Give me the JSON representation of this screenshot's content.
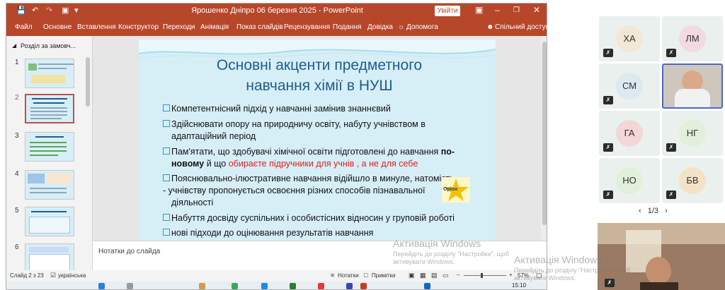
{
  "window": {
    "title": "Ярошенко Дніпро 06 березня  2025  -  PowerPoint",
    "sign_in": "Увійти"
  },
  "ribbon": {
    "tabs": [
      "Файл",
      "Основне",
      "Вставлення",
      "Конструктор",
      "Переходи",
      "Анімація",
      "Показ слайдів",
      "Рецензування",
      "Подання",
      "Довідка"
    ],
    "help": "Допомога",
    "share": "Спільний доступ"
  },
  "sidebar": {
    "section": "Розділ за замовч...",
    "slides": [
      "1",
      "2",
      "3",
      "4",
      "5",
      "6"
    ],
    "selected": "2"
  },
  "slide": {
    "title_line1": "Основні  акценти  предметного",
    "title_line2": "навчання хімії в НУШ",
    "bullets": [
      {
        "text": "Компетентнісний підхід  у навчанні замінив знаннєвий"
      },
      {
        "text": "Здійснювати опору на природничу освіту, набуту учнівством  в",
        "cont": "адаптаційний період"
      },
      {
        "pre": "Пам'ятати, що здобувачі хімічної освіти підготовлені до навчання ",
        "bold1": "по-",
        "bold2": "новому",
        "mid": "  й що ",
        "red": "обираєте підручники для учнів , а не для себе"
      },
      {
        "text": "Пояснювально-ілюстративне навчання відійшло в минуле, натомість",
        "cont": "- учнівству пропонується освоєння різних  способів пізнавальної",
        "cont2": "діяльності"
      },
      {
        "text": "Набуття досвіду суспільних і особистісних відносин у груповій роботі"
      },
      {
        "text": "нові підходи до оцінювання результатів навчання"
      }
    ],
    "logo": "Оріон"
  },
  "notes": {
    "placeholder": "Нотатки до слайда"
  },
  "status": {
    "slide": "Слайд 2 з 23",
    "lang": "українська",
    "notes": "Нотатки",
    "comments": "Примітки",
    "zoom": "57%"
  },
  "taskbar": {
    "time": "15:10"
  },
  "watermark": {
    "title": "Активація Windows",
    "line1": "Перейдіть до розділу \"Настройки\", щоб",
    "line2": "активувати Windows."
  },
  "participants": {
    "tiles": [
      {
        "initials": "ХА",
        "color": "#f2e8d5"
      },
      {
        "initials": "ЛМ",
        "color": "#f2d9e2"
      },
      {
        "initials": "СМ",
        "color": "#dde8f0"
      },
      {
        "initials": "ГА",
        "color": "#f4d6d6"
      },
      {
        "initials": "НГ",
        "color": "#e2efd9"
      },
      {
        "initials": "НО",
        "color": "#e2efd9"
      },
      {
        "initials": "БВ",
        "color": "#f4e2c6"
      }
    ],
    "pager": "1/3"
  }
}
